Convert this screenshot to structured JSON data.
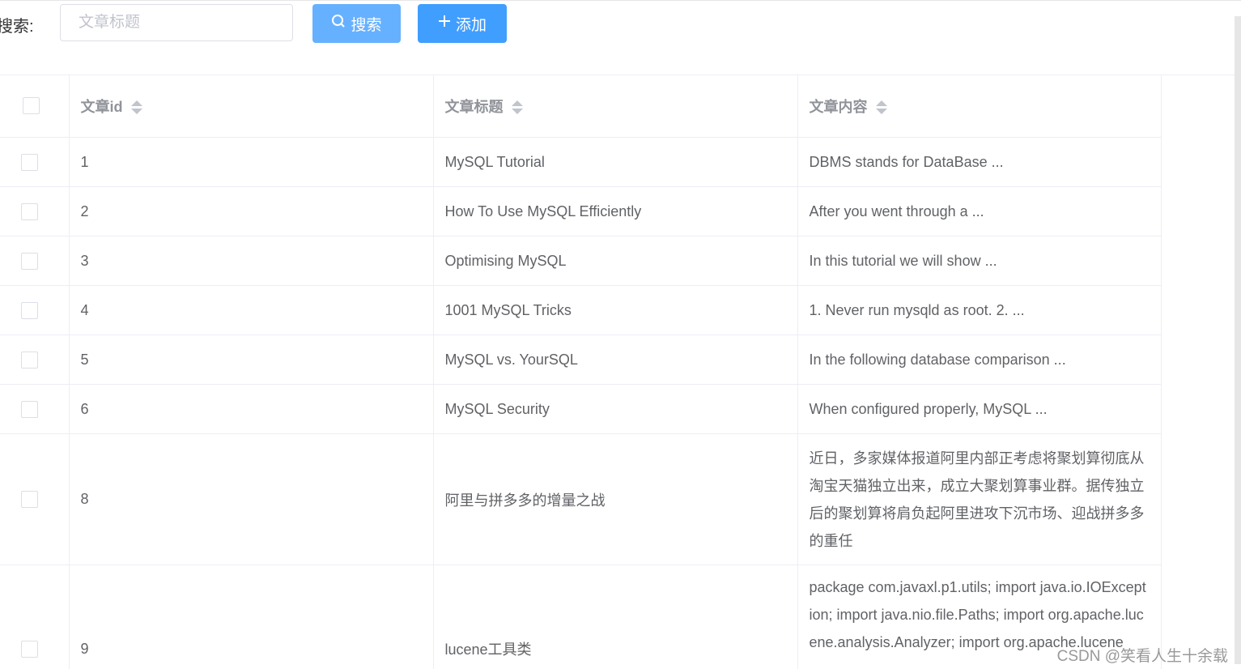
{
  "toolbar": {
    "search_label": "搜索:",
    "search_placeholder": "文章标题",
    "search_button": "搜索",
    "add_button": "添加"
  },
  "table": {
    "headers": [
      "文章id",
      "文章标题",
      "文章内容"
    ],
    "rows": [
      {
        "id": "1",
        "title": "MySQL Tutorial",
        "content": "DBMS stands for DataBase ..."
      },
      {
        "id": "2",
        "title": "How To Use MySQL Efficiently",
        "content": "After you went through a ..."
      },
      {
        "id": "3",
        "title": "Optimising MySQL",
        "content": "In this tutorial we will show ..."
      },
      {
        "id": "4",
        "title": "1001 MySQL Tricks",
        "content": "1. Never run mysqld as root. 2. ..."
      },
      {
        "id": "5",
        "title": "MySQL vs. YourSQL",
        "content": "In the following database comparison ..."
      },
      {
        "id": "6",
        "title": "MySQL Security",
        "content": "When configured properly, MySQL ..."
      },
      {
        "id": "8",
        "title": "阿里与拼多多的增量之战",
        "content": "近日，多家媒体报道阿里内部正考虑将聚划算彻底从淘宝天猫独立出来，成立大聚划算事业群。据传独立后的聚划算将肩负起阿里进攻下沉市场、迎战拼多多的重任"
      },
      {
        "id": "9",
        "title": "lucene工具类",
        "content": "package com.javaxl.p1.utils; import java.io.IOException; import java.nio.file.Paths; import org.apache.lucene.analysis.Analyzer; import org.apache.lucene"
      }
    ]
  },
  "watermark": "CSDN @笑看人生十余载",
  "colors": {
    "primary": "#409eff",
    "primary_light": "#66b1ff",
    "border": "#ebeef5",
    "header_text": "#909399",
    "text": "#606266"
  },
  "icons": {
    "search_button": "search-icon",
    "add_button": "plus-icon",
    "sort": "sort-caret-icon"
  }
}
